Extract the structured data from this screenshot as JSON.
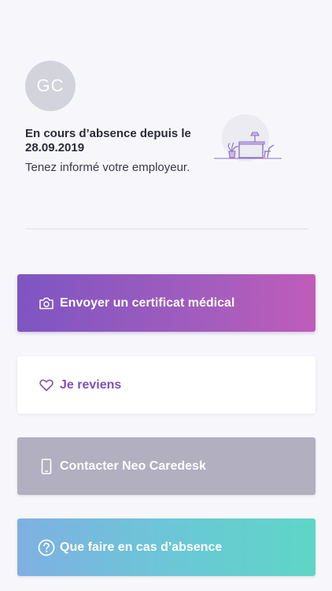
{
  "profile": {
    "initials": "GC",
    "status_title": "En cours d’absence depuis le 28.09.2019",
    "status_subtitle": "Tenez informé votre employeur."
  },
  "actions": [
    {
      "label": "Envoyer un certificat médical",
      "icon": "camera-icon"
    },
    {
      "label": "Je reviens",
      "icon": "heart-icon"
    },
    {
      "label": "Contacter Neo Caredesk",
      "icon": "phone-icon"
    },
    {
      "label": "Que faire en cas d’absence",
      "icon": "question-icon"
    }
  ],
  "colors": {
    "background": "#f7f7fb",
    "avatar": "#d3d3dc",
    "primary_purple": "#7e55c2",
    "accent_pink": "#c05cba",
    "contact_grey": "#b2afc0",
    "help_blue": "#7fb0e2",
    "help_teal": "#5ed6c6"
  }
}
